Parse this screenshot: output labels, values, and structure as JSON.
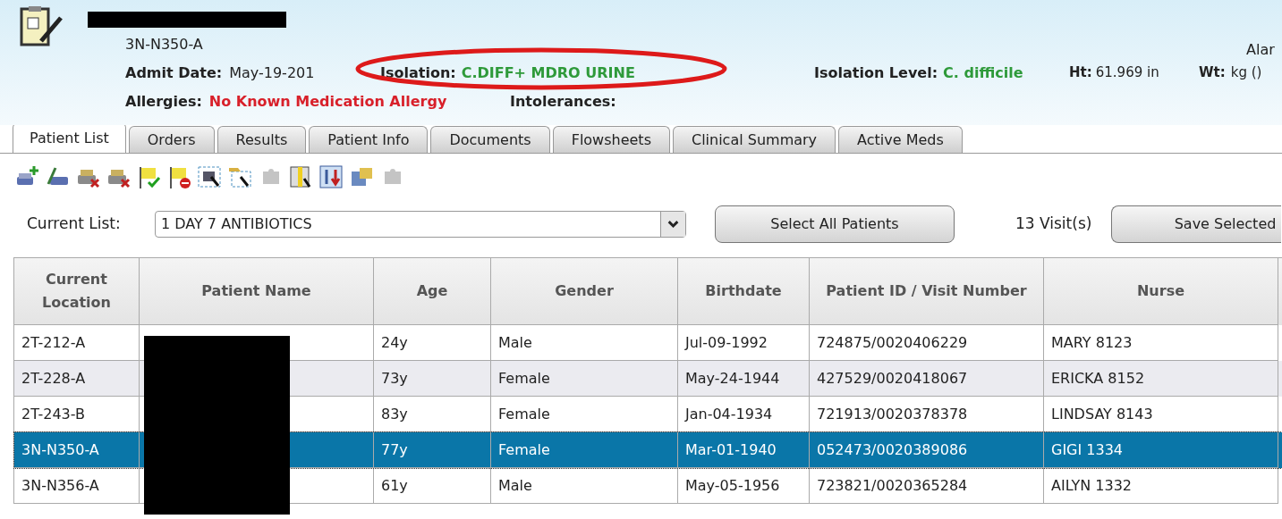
{
  "patient_header": {
    "location": "3N-N350-A",
    "cut_label": "Alar",
    "admit_date_label": "Admit Date:",
    "admit_date": "May-19-201",
    "isolation_label": "Isolation:",
    "isolation": "C.DIFF+ MDRO URINE",
    "isolation_level_label": "Isolation Level:",
    "isolation_level": "C. difficile",
    "height_label": "Ht:",
    "height": "61.969 in",
    "weight_label": "Wt:",
    "weight": "kg ()",
    "allergies_label": "Allergies:",
    "allergies": "No Known Medication Allergy",
    "intolerances_label": "Intolerances:"
  },
  "tabs": [
    {
      "label": "Patient List",
      "selected": true
    },
    {
      "label": "Orders",
      "selected": false
    },
    {
      "label": "Results",
      "selected": false
    },
    {
      "label": "Patient Info",
      "selected": false
    },
    {
      "label": "Documents",
      "selected": false
    },
    {
      "label": "Flowsheets",
      "selected": false
    },
    {
      "label": "Clinical Summary",
      "selected": false
    },
    {
      "label": "Active Meds",
      "selected": false
    }
  ],
  "toolbar": [
    {
      "kind": "tray-add",
      "disabled": false
    },
    {
      "kind": "tray-edit",
      "disabled": false
    },
    {
      "kind": "tray-remove",
      "disabled": false
    },
    {
      "kind": "tray-remove",
      "disabled": false
    },
    {
      "kind": "flag-check",
      "disabled": false
    },
    {
      "kind": "flag-block",
      "disabled": false
    },
    {
      "kind": "window-select",
      "disabled": false
    },
    {
      "kind": "folder-select",
      "disabled": false
    },
    {
      "kind": "puzzle",
      "disabled": true
    },
    {
      "kind": "grid",
      "disabled": false
    },
    {
      "kind": "sort",
      "disabled": false
    },
    {
      "kind": "folder",
      "disabled": false
    },
    {
      "kind": "puzzle",
      "disabled": true
    }
  ],
  "list_bar": {
    "label": "Current List:",
    "value": "1 DAY 7 ANTIBIOTICS",
    "select_all": "Select All Patients",
    "count": "13 Visit(s)",
    "save": "Save Selected"
  },
  "table": {
    "columns": [
      "Current Location",
      "Patient Name",
      "Age",
      "Gender",
      "Birthdate",
      "Patient ID / Visit Number",
      "Nurse"
    ],
    "rows": [
      {
        "location": "2T-212-A",
        "age": "24y",
        "gender": "Male",
        "birthdate": "Jul-09-1992",
        "id": "724875/0020406229",
        "nurse": "MARY 8123",
        "selected": false
      },
      {
        "location": "2T-228-A",
        "age": "73y",
        "gender": "Female",
        "birthdate": "May-24-1944",
        "id": "427529/0020418067",
        "nurse": "ERICKA 8152",
        "selected": false
      },
      {
        "location": "2T-243-B",
        "age": "83y",
        "gender": "Female",
        "birthdate": "Jan-04-1934",
        "id": "721913/0020378378",
        "nurse": "LINDSAY 8143",
        "selected": false
      },
      {
        "location": "3N-N350-A",
        "age": "77y",
        "gender": "Female",
        "birthdate": "Mar-01-1940",
        "id": "052473/0020389086",
        "nurse": "GIGI 1334",
        "selected": true
      },
      {
        "location": "3N-N356-A",
        "age": "61y",
        "gender": "Male",
        "birthdate": "May-05-1956",
        "id": "723821/0020365284",
        "nurse": "AILYN 1332",
        "selected": false
      }
    ]
  }
}
